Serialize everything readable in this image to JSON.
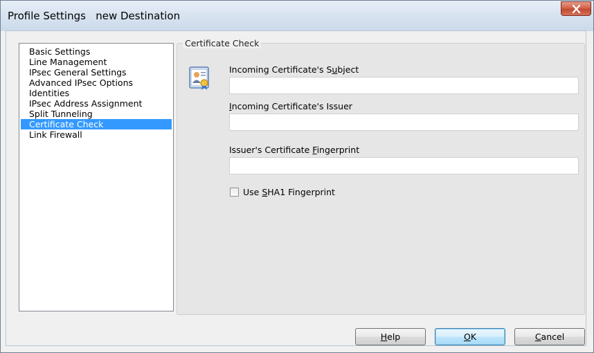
{
  "window": {
    "title": "Profile Settings   new Destination"
  },
  "nav": {
    "items": [
      {
        "label": "Basic Settings"
      },
      {
        "label": "Line Management"
      },
      {
        "label": "IPsec General Settings"
      },
      {
        "label": "Advanced IPsec Options"
      },
      {
        "label": "Identities"
      },
      {
        "label": "IPsec Address Assignment"
      },
      {
        "label": "Split Tunneling"
      },
      {
        "label": "Certificate Check"
      },
      {
        "label": "Link Firewall"
      }
    ],
    "selected": "Certificate Check"
  },
  "panel": {
    "legend": "Certificate Check",
    "icon": "certificate-icon",
    "subject": {
      "label_pre": "Incoming Certificate's S",
      "label_u": "u",
      "label_post": "bject",
      "value": ""
    },
    "issuer": {
      "label_pre": "",
      "label_u": "I",
      "label_post": "ncoming Certificate's Issuer",
      "value": ""
    },
    "fingerprint": {
      "label_pre": "Issuer's Certificate ",
      "label_u": "F",
      "label_post": "ingerprint",
      "value": ""
    },
    "sha1": {
      "label_pre": "Use ",
      "label_u": "S",
      "label_post": "HA1 Fingerprint",
      "checked": false
    }
  },
  "buttons": {
    "help": {
      "pre": "",
      "u": "H",
      "post": "elp"
    },
    "ok": {
      "pre": "",
      "u": "O",
      "post": "K"
    },
    "cancel": {
      "pre": "",
      "u": "C",
      "post": "ancel"
    }
  },
  "colors": {
    "selection": "#3399ff",
    "close": "#c24a33",
    "default_button": "#3c7fb1"
  }
}
